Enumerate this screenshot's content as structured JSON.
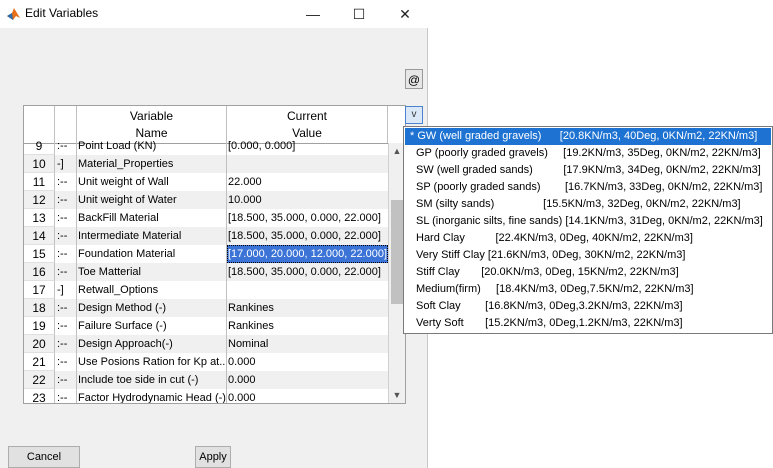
{
  "window": {
    "title": "Edit Variables",
    "minimize": "—",
    "maximize": "☐",
    "close": "✕"
  },
  "at_button": "@",
  "table": {
    "headers": {
      "variable": [
        "Variable",
        "Name"
      ],
      "current": [
        "Current",
        "Value"
      ]
    },
    "rows": [
      {
        "num": "9",
        "tree": ":--",
        "name": "Point Load (KN)",
        "value": "[0.000, 0.000]"
      },
      {
        "num": "10",
        "tree": "-]",
        "name": "Material_Properties",
        "value": ""
      },
      {
        "num": "11",
        "tree": ":--",
        "name": "Unit weight of Wall",
        "value": "22.000"
      },
      {
        "num": "12",
        "tree": ":--",
        "name": "Unit weight of Water",
        "value": "10.000"
      },
      {
        "num": "13",
        "tree": ":--",
        "name": "BackFill Material",
        "value": "[18.500, 35.000, 0.000, 22.000]"
      },
      {
        "num": "14",
        "tree": ":--",
        "name": "Intermediate Material",
        "value": "[18.500, 35.000, 0.000, 22.000]"
      },
      {
        "num": "15",
        "tree": ":--",
        "name": "Foundation Material",
        "value": "[17.000, 20.000, 12.000, 22.000]"
      },
      {
        "num": "16",
        "tree": ":--",
        "name": "Toe Matterial",
        "value": "[18.500, 35.000, 0.000, 22.000]"
      },
      {
        "num": "17",
        "tree": "-]",
        "name": "Retwall_Options",
        "value": ""
      },
      {
        "num": "18",
        "tree": ":--",
        "name": "Design Method (-)",
        "value": "Rankines"
      },
      {
        "num": "19",
        "tree": ":--",
        "name": "Failure Surface (-)",
        "value": "Rankines"
      },
      {
        "num": "20",
        "tree": ":--",
        "name": "Design Approach(-)",
        "value": "Nominal"
      },
      {
        "num": "21",
        "tree": ":--",
        "name": "Use Posions Ration for Kp at...",
        "value": "0.000"
      },
      {
        "num": "22",
        "tree": ":--",
        "name": "Include toe side in cut (-)",
        "value": "0.000"
      },
      {
        "num": "23",
        "tree": ":--",
        "name": "Factor Hydrodynamic Head (-)",
        "value": "0.000"
      }
    ]
  },
  "dropdown": {
    "arrow": "v",
    "items": [
      "* GW (well graded gravels)      [20.8KN/m3, 40Deg, 0KN/m2, 22KN/m3]",
      "GP (poorly graded gravels)     [19.2KN/m3, 35Deg, 0KN/m2, 22KN/m3]",
      "SW (well graded sands)          [17.9KN/m3, 34Deg, 0KN/m2, 22KN/m3]",
      "SP (poorly graded sands)        [16.7KN/m3, 33Deg, 0KN/m2, 22KN/m3]",
      "SM (silty sands)                [15.5KN/m3, 32Deg, 0KN/m2, 22KN/m3]",
      "SL (inorganic silts, fine sands) [14.1KN/m3, 31Deg, 0KN/m2, 22KN/m3]",
      "Hard Clay          [22.4KN/m3, 0Deg, 40KN/m2, 22KN/m3]",
      "Very Stiff Clay [21.6KN/m3, 0Deg, 30KN/m2, 22KN/m3]",
      "Stiff Clay       [20.0KN/m3, 0Deg, 15KN/m2, 22KN/m3]",
      "Medium(firm)     [18.4KN/m3, 0Deg,7.5KN/m2, 22KN/m3]",
      "Soft Clay        [16.8KN/m3, 0Deg,3.2KN/m3, 22KN/m3]",
      "Verty Soft       [15.2KN/m3, 0Deg,1.2KN/m3, 22KN/m3]"
    ]
  },
  "buttons": {
    "cancel": "Cancel",
    "apply": "Apply"
  }
}
